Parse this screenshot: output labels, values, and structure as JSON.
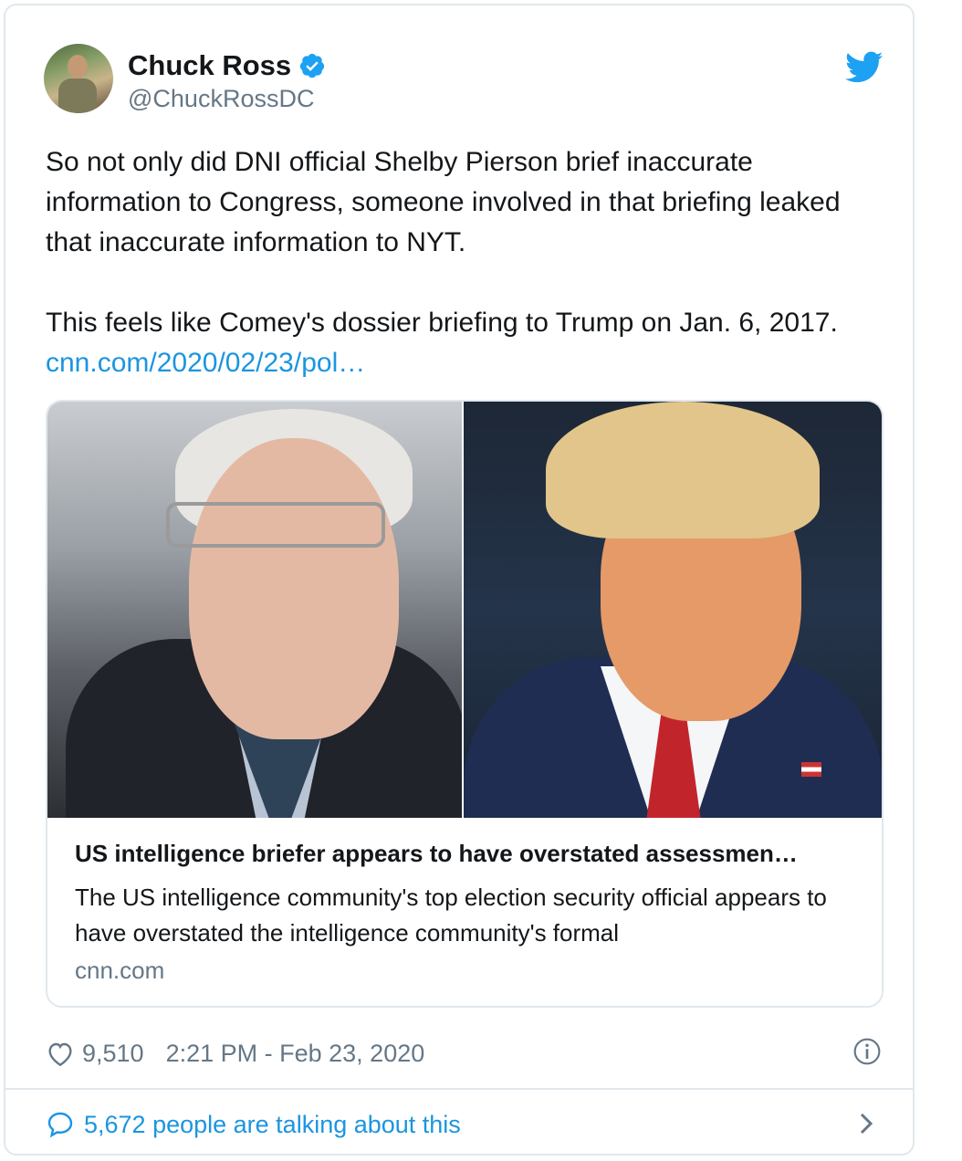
{
  "author": {
    "display_name": "Chuck Ross",
    "handle": "@ChuckRossDC",
    "verified": true
  },
  "tweet": {
    "paragraph_1": "So not only did DNI official Shelby Pierson brief inaccurate information to Congress, someone involved in that briefing leaked that inaccurate information to NYT.",
    "paragraph_2_text": "This feels like Comey's dossier briefing to Trump on Jan. 6, 2017.",
    "link_text": "cnn.com/2020/02/23/pol…"
  },
  "link_card": {
    "title": "US intelligence briefer appears to have overstated assessmen…",
    "description": "The US intelligence community's top election security official appears to have overstated the intelligence community's formal",
    "domain": "cnn.com"
  },
  "meta": {
    "like_count": "9,510",
    "timestamp": "2:21 PM - Feb 23, 2020"
  },
  "conversation": {
    "label": "5,672 people are talking about this"
  },
  "icons": {
    "verified": "verified-badge-icon",
    "bird": "twitter-bird-icon",
    "like": "heart-icon",
    "info": "info-icon",
    "conversation": "speech-bubble-icon",
    "chevron": "chevron-right-icon"
  },
  "colors": {
    "link": "#1b95e0",
    "secondary_text": "#657786",
    "border": "#e1e8ed"
  }
}
